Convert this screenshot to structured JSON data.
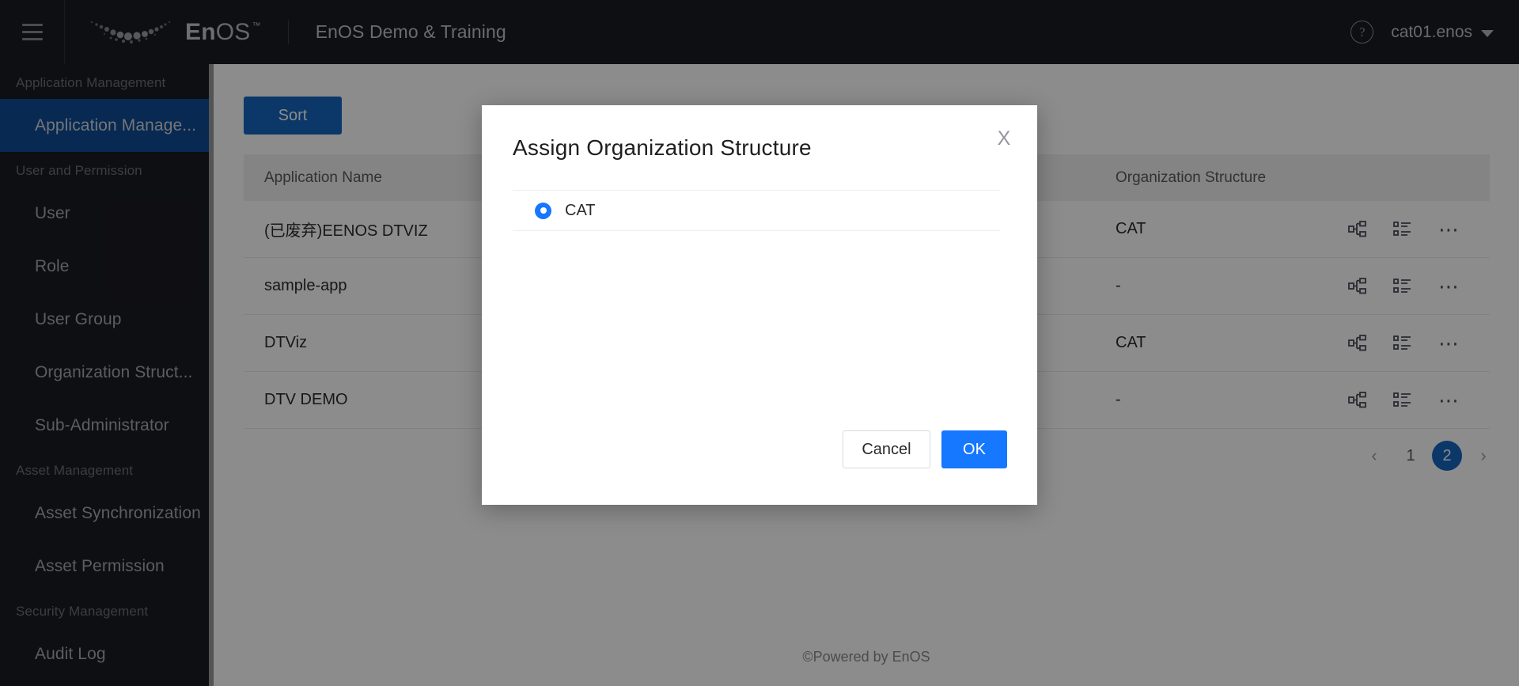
{
  "header": {
    "menu_icon": "hamburger-icon",
    "logo_icon": "enos-logo-icon",
    "brand_bold": "En",
    "brand_light": "OS",
    "brand_tm": "™",
    "workspace": "EnOS Demo & Training",
    "help_icon": "help-circle-icon",
    "user": "cat01.enos",
    "caret_icon": "chevron-down-icon"
  },
  "sidebar": {
    "groups": [
      {
        "title": "Application Management",
        "items": [
          {
            "label": "Application Manage...",
            "active": true
          }
        ]
      },
      {
        "title": "User and Permission",
        "items": [
          {
            "label": "User",
            "active": false
          },
          {
            "label": "Role",
            "active": false
          },
          {
            "label": "User Group",
            "active": false
          },
          {
            "label": "Organization Struct...",
            "active": false
          },
          {
            "label": "Sub-Administrator",
            "active": false
          }
        ]
      },
      {
        "title": "Asset Management",
        "items": [
          {
            "label": "Asset Synchronization",
            "active": false
          },
          {
            "label": "Asset Permission",
            "active": false
          }
        ]
      },
      {
        "title": "Security Management",
        "items": [
          {
            "label": "Audit Log",
            "active": false
          }
        ]
      }
    ]
  },
  "toolbar": {
    "sort_label": "Sort"
  },
  "table": {
    "columns": [
      "Application Name",
      "",
      "Organization Structure",
      ""
    ],
    "rows": [
      {
        "name": "(已废弃)EENOS DTVIZ",
        "mid": "",
        "org": "CAT"
      },
      {
        "name": "sample-app",
        "mid": "",
        "org": "-"
      },
      {
        "name": "DTViz",
        "mid": "",
        "org": "CAT"
      },
      {
        "name": "DTV DEMO",
        "mid": "",
        "org": "-"
      }
    ],
    "row_action_icons": [
      "org-chart-icon",
      "list-detail-icon",
      "more-options-icon"
    ]
  },
  "pagination": {
    "prev_icon": "‹",
    "next_icon": "›",
    "pages": [
      "1",
      "2"
    ],
    "current": "2"
  },
  "footer": {
    "copyright": "©Powered by EnOS"
  },
  "modal": {
    "title": "Assign Organization Structure",
    "close_icon": "×",
    "close_label": "X",
    "options": [
      {
        "label": "CAT",
        "selected": true
      }
    ],
    "cancel_label": "Cancel",
    "ok_label": "OK"
  },
  "colors": {
    "header_bg": "#1b1c22",
    "sidebar_bg": "#1b1c22",
    "sidebar_active": "#0e4c96",
    "primary_button": "#1665c0",
    "modal_primary": "#1677ff",
    "radio_selected": "#1677ff",
    "overlay": "rgba(0,0,0,0.45)"
  }
}
